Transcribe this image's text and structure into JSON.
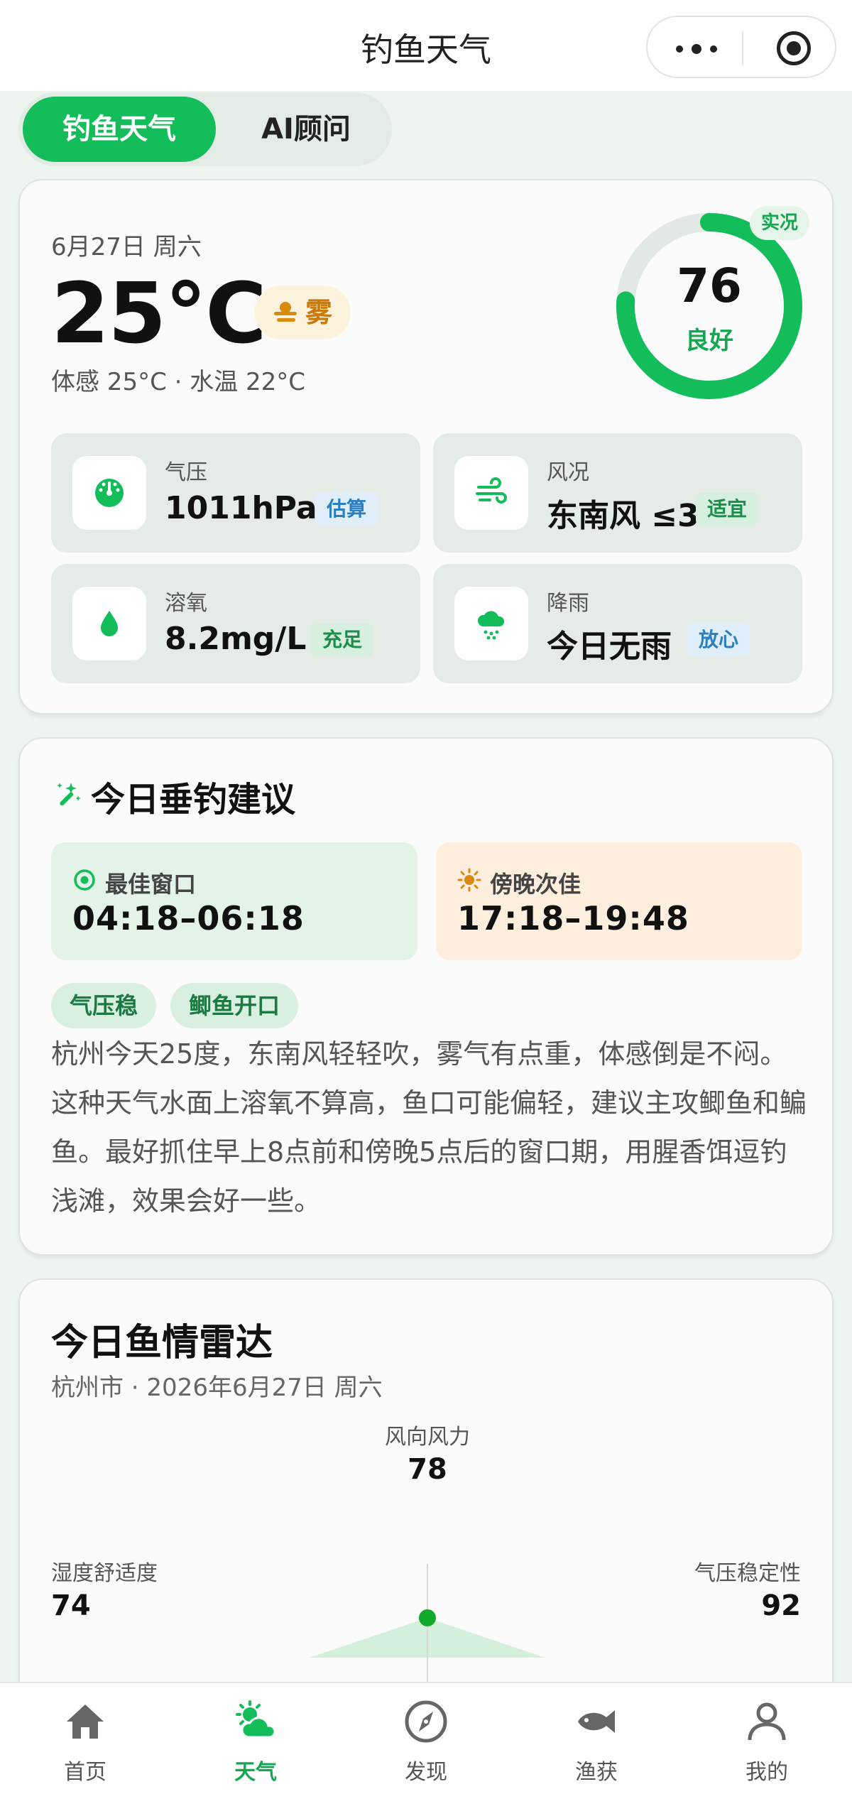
{
  "app": {
    "title": "钓鱼天气"
  },
  "tabs": {
    "weather": "钓鱼天气",
    "ai": "AI顾问"
  },
  "current": {
    "date": "6月27日 周六",
    "temp": "25°C",
    "condition": "雾",
    "feel": "体感 25°C · 水温 22°C",
    "score": "76",
    "score_value": 76,
    "score_max": 100,
    "grade": "良好",
    "live_tag": "实况"
  },
  "metrics": [
    {
      "label": "气压",
      "value": "1011hPa",
      "tag": "估算",
      "icon": "gauge-icon",
      "tag_color": "#2b7ec2"
    },
    {
      "label": "风况",
      "value": "东南风 ≤3",
      "tag": "适宜",
      "icon": "wind-icon",
      "tag_color": "#1b8e4b"
    },
    {
      "label": "溶氧",
      "value": "8.2mg/L",
      "tag": "充足",
      "icon": "water-drop-icon",
      "tag_color": "#1b8e4b"
    },
    {
      "label": "降雨",
      "value": "今日无雨",
      "tag": "放心",
      "icon": "rain-cloud-icon",
      "tag_color": "#2b7ec2"
    }
  ],
  "advice": {
    "title": "今日垂钓建议",
    "best": {
      "label": "最佳窗口",
      "value": "04:18–06:18"
    },
    "next": {
      "label": "傍晚次佳",
      "value": "17:18–19:48"
    },
    "chips": [
      "气压稳",
      "鲫鱼开口"
    ],
    "text": "杭州今天25度，东南风轻轻吹，雾气有点重，体感倒是不闷。这种天气水面上溶氧不算高，鱼口可能偏轻，建议主攻鲫鱼和鳊鱼。最好抓住早上8点前和傍晚5点后的窗口期，用腥香饵逗钓浅滩，效果会好一些。"
  },
  "radar": {
    "title": "今日鱼情雷达",
    "subtitle": "杭州市 · 2026年6月27日 周六",
    "axes": [
      {
        "label": "风向风力",
        "value": "78"
      },
      {
        "label": "湿度舒适度",
        "value": "74"
      },
      {
        "label": "气压稳定性",
        "value": "92"
      }
    ]
  },
  "nav": [
    {
      "label": "首页",
      "icon": "home-icon"
    },
    {
      "label": "天气",
      "icon": "weather-icon"
    },
    {
      "label": "发现",
      "icon": "compass-icon"
    },
    {
      "label": "渔获",
      "icon": "fish-icon"
    },
    {
      "label": "我的",
      "icon": "profile-icon"
    }
  ],
  "colors": {
    "accent": "#12bd5a",
    "accent_text": "#12a84f",
    "fog_badge": "#c97a0a",
    "window_next_icon": "#d98a10"
  }
}
